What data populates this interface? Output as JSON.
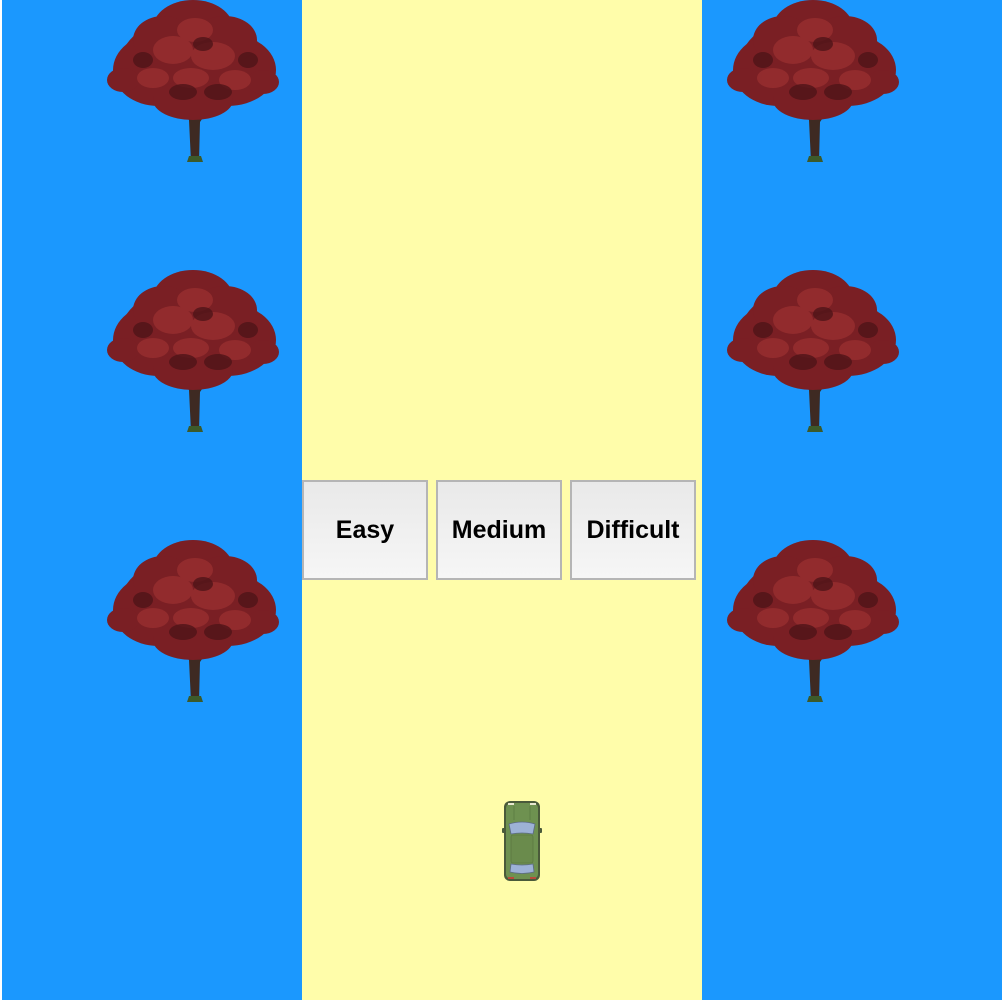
{
  "scene": {
    "grass_color": "#1b98fe",
    "road_color": "#fffdaa",
    "tree_icon": "tree-icon",
    "car_icon": "car-icon",
    "car_color": "#6e9150"
  },
  "difficulty": {
    "easy_label": "Easy",
    "medium_label": "Medium",
    "difficult_label": "Difficult"
  }
}
